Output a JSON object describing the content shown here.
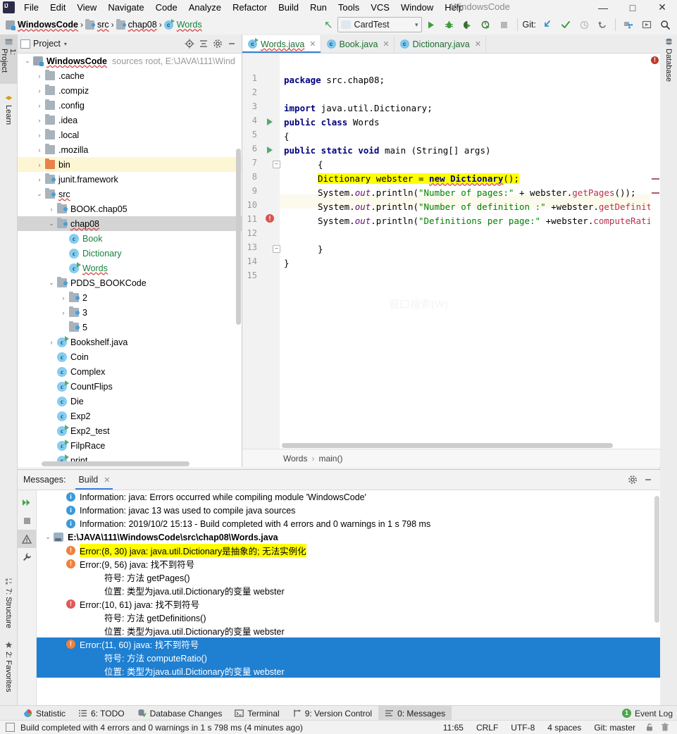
{
  "window": {
    "title": "WindowsCode",
    "minimize": "—",
    "maximize": "□",
    "close": "✕"
  },
  "menubar": {
    "items": [
      "File",
      "Edit",
      "View",
      "Navigate",
      "Code",
      "Analyze",
      "Refactor",
      "Build",
      "Run",
      "Tools",
      "VCS",
      "Window",
      "Help"
    ]
  },
  "navbar": {
    "breadcrumbs": [
      {
        "label": "WindowsCode",
        "icon": "module-icon",
        "style": "bold"
      },
      {
        "label": "src",
        "icon": "source-folder-icon",
        "style": "plain"
      },
      {
        "label": "chap08",
        "icon": "source-folder-icon",
        "style": "plain"
      },
      {
        "label": "Words",
        "icon": "java-class-runnable-icon",
        "style": "green"
      }
    ],
    "separator": "›",
    "run_config": {
      "value": "CardTest",
      "caret": "▾"
    },
    "git_label": "Git:",
    "icons": [
      "run-icon",
      "debug-icon",
      "run-with-coverage-icon",
      "profile-icon",
      "stop-icon",
      "update-project-icon",
      "commit-icon",
      "history-icon",
      "rollback-icon",
      "project-structure-icon",
      "select-in-icon",
      "search-everywhere-icon"
    ]
  },
  "left_stripe": {
    "top": [
      {
        "label": "1: Project",
        "icon": "project-icon",
        "active": true
      },
      {
        "label": "Learn",
        "icon": "learn-icon",
        "active": false
      }
    ],
    "bottom": [
      {
        "label": "7: Structure",
        "icon": "structure-icon",
        "active": false
      },
      {
        "label": "2: Favorites",
        "icon": "star-icon",
        "active": false
      }
    ]
  },
  "right_stripe": {
    "items": [
      {
        "label": "Database",
        "icon": "database-icon"
      }
    ]
  },
  "project_panel": {
    "title": "Project",
    "caret": "▾",
    "actions": [
      "locate-icon",
      "collapse-all-icon",
      "settings-gear-icon",
      "hide-icon"
    ],
    "tree": [
      {
        "indent": 0,
        "arrow": "v",
        "icon": "module-icon",
        "label": "WindowsCode",
        "style": "bold",
        "sub": "sources root,  E:\\JAVA\\111\\Wind",
        "state": "normal"
      },
      {
        "indent": 1,
        "arrow": ">",
        "icon": "folder-icon",
        "label": ".cache",
        "style": "plain",
        "sub": "",
        "state": "normal"
      },
      {
        "indent": 1,
        "arrow": ">",
        "icon": "folder-icon",
        "label": ".compiz",
        "style": "plain",
        "sub": "",
        "state": "normal"
      },
      {
        "indent": 1,
        "arrow": ">",
        "icon": "folder-icon",
        "label": ".config",
        "style": "plain",
        "sub": "",
        "state": "normal"
      },
      {
        "indent": 1,
        "arrow": ">",
        "icon": "folder-icon",
        "label": ".idea",
        "style": "plain",
        "sub": "",
        "state": "normal"
      },
      {
        "indent": 1,
        "arrow": ">",
        "icon": "folder-icon",
        "label": ".local",
        "style": "plain",
        "sub": "",
        "state": "normal"
      },
      {
        "indent": 1,
        "arrow": ">",
        "icon": "folder-icon",
        "label": ".mozilla",
        "style": "plain",
        "sub": "",
        "state": "normal"
      },
      {
        "indent": 1,
        "arrow": ">",
        "icon": "output-folder-icon",
        "label": "bin",
        "style": "plain",
        "sub": "",
        "state": "highlight"
      },
      {
        "indent": 1,
        "arrow": ">",
        "icon": "source-folder-icon",
        "label": "junit.framework",
        "style": "plain",
        "sub": "",
        "state": "normal"
      },
      {
        "indent": 1,
        "arrow": "v",
        "icon": "source-folder-icon",
        "label": "src",
        "style": "plain",
        "sub": "",
        "state": "normal"
      },
      {
        "indent": 2,
        "arrow": ">",
        "icon": "source-folder-icon",
        "label": "BOOK.chap05",
        "style": "plain",
        "sub": "",
        "state": "normal"
      },
      {
        "indent": 2,
        "arrow": "v",
        "icon": "source-folder-icon",
        "label": "chap08",
        "style": "plain",
        "sub": "",
        "state": "selected"
      },
      {
        "indent": 3,
        "arrow": "",
        "icon": "java-class-icon",
        "label": "Book",
        "style": "green",
        "sub": "",
        "state": "normal"
      },
      {
        "indent": 3,
        "arrow": "",
        "icon": "java-class-icon",
        "label": "Dictionary",
        "style": "green",
        "sub": "",
        "state": "normal"
      },
      {
        "indent": 3,
        "arrow": "",
        "icon": "java-class-runnable-icon",
        "label": "Words",
        "style": "green",
        "sub": "",
        "state": "normal"
      },
      {
        "indent": 2,
        "arrow": "v",
        "icon": "source-folder-icon",
        "label": "PDDS_BOOKCode",
        "style": "plain",
        "sub": "",
        "state": "normal"
      },
      {
        "indent": 3,
        "arrow": ">",
        "icon": "source-folder-icon",
        "label": "2",
        "style": "plain",
        "sub": "",
        "state": "normal"
      },
      {
        "indent": 3,
        "arrow": ">",
        "icon": "source-folder-icon",
        "label": "3",
        "style": "plain",
        "sub": "",
        "state": "normal"
      },
      {
        "indent": 3,
        "arrow": "",
        "icon": "source-folder-icon",
        "label": "5",
        "style": "plain",
        "sub": "",
        "state": "normal"
      },
      {
        "indent": 2,
        "arrow": ">",
        "icon": "java-class-runnable-icon",
        "label": "Bookshelf.java",
        "style": "plain",
        "sub": "",
        "state": "normal"
      },
      {
        "indent": 2,
        "arrow": "",
        "icon": "java-class-icon",
        "label": "Coin",
        "style": "plain",
        "sub": "",
        "state": "normal"
      },
      {
        "indent": 2,
        "arrow": "",
        "icon": "java-class-icon",
        "label": "Complex",
        "style": "plain",
        "sub": "",
        "state": "normal"
      },
      {
        "indent": 2,
        "arrow": "",
        "icon": "java-class-runnable-icon",
        "label": "CountFlips",
        "style": "plain",
        "sub": "",
        "state": "normal"
      },
      {
        "indent": 2,
        "arrow": "",
        "icon": "java-class-icon",
        "label": "Die",
        "style": "plain",
        "sub": "",
        "state": "normal"
      },
      {
        "indent": 2,
        "arrow": "",
        "icon": "java-class-icon",
        "label": "Exp2",
        "style": "plain",
        "sub": "",
        "state": "normal"
      },
      {
        "indent": 2,
        "arrow": "",
        "icon": "java-class-runnable-icon",
        "label": "Exp2_test",
        "style": "plain",
        "sub": "",
        "state": "normal"
      },
      {
        "indent": 2,
        "arrow": "",
        "icon": "java-class-runnable-icon",
        "label": "FilpRace",
        "style": "plain",
        "sub": "",
        "state": "normal"
      },
      {
        "indent": 2,
        "arrow": "",
        "icon": "java-class-runnable-icon",
        "label": "print",
        "style": "plain",
        "sub": "",
        "state": "normal"
      }
    ]
  },
  "editor": {
    "tabs": [
      {
        "label": "Words.java",
        "icon": "java-class-runnable-icon",
        "active": true,
        "close": "✕",
        "color": "green"
      },
      {
        "label": "Book.java",
        "icon": "java-class-icon",
        "active": false,
        "close": "✕",
        "color": "green"
      },
      {
        "label": "Dictionary.java",
        "icon": "java-class-icon",
        "active": false,
        "close": "✕",
        "color": "green"
      }
    ],
    "line_numbers": [
      "1",
      "2",
      "3",
      "4",
      "5",
      "6",
      "7",
      "8",
      "9",
      "10",
      "11",
      "12",
      "13",
      "14",
      "15"
    ],
    "code": [
      "package src.chap08;",
      "",
      "import java.util.Dictionary;",
      "public class Words",
      "{",
      "public static void main (String[] args)",
      "        {",
      "        Dictionary webster = new Dictionary();",
      "        System.out.println(\"Number of pages:\" + webster.getPages());",
      "        System.out.println(\"Number of definition :\" +webster.getDefinitions(",
      "        System.out.println(\"Definitions per page:\" +webster.computeRatio());",
      "",
      "        }",
      "}",
      ""
    ],
    "watermark": "窗口搜索(W)",
    "error_marker_count": "!",
    "breadcrumb": {
      "items": [
        "Words",
        "main()"
      ],
      "separator": "›"
    }
  },
  "messages": {
    "label": "Messages:",
    "tab": {
      "label": "Build",
      "close": "✕"
    },
    "header_actions": [
      "settings-gear-icon",
      "hide-icon"
    ],
    "toolbar_icons": [
      "rerun-icon",
      "stop-icon",
      "toggle-warnings-icon",
      "settings-wrench-icon"
    ],
    "rows": [
      {
        "type": "info",
        "indent": 1,
        "text": "Information: java: Errors occurred while compiling module 'WindowsCode'",
        "state": "normal"
      },
      {
        "type": "info",
        "indent": 1,
        "text": "Information: javac 13 was used to compile java sources",
        "state": "normal"
      },
      {
        "type": "info",
        "indent": 1,
        "text": "Information: 2019/10/2 15:13 - Build completed with 4 errors and 0 warnings in 1 s 798 ms",
        "state": "normal"
      },
      {
        "type": "file",
        "indent": 0,
        "arrow": "v",
        "text": "E:\\JAVA\\111\\WindowsCode\\src\\chap08\\Words.java",
        "state": "normal"
      },
      {
        "type": "error",
        "indent": 1,
        "text": "Error:(8, 30)  java: java.util.Dictionary是抽象的; 无法实例化",
        "state": "highlight"
      },
      {
        "type": "error",
        "indent": 1,
        "text": "Error:(9, 56)  java: 找不到符号",
        "state": "normal"
      },
      {
        "type": "plain",
        "indent": 4,
        "text": "符号:   方法 getPages()",
        "state": "normal"
      },
      {
        "type": "plain",
        "indent": 4,
        "text": "位置: 类型为java.util.Dictionary的变量 webster",
        "state": "normal"
      },
      {
        "type": "error",
        "indent": 1,
        "text": "Error:(10, 61)  java: 找不到符号",
        "state": "normal"
      },
      {
        "type": "plain",
        "indent": 4,
        "text": "符号:   方法 getDefinitions()",
        "state": "normal"
      },
      {
        "type": "plain",
        "indent": 4,
        "text": "位置: 类型为java.util.Dictionary的变量 webster",
        "state": "normal"
      },
      {
        "type": "error",
        "indent": 1,
        "text": "Error:(11, 60)  java: 找不到符号",
        "state": "selected"
      },
      {
        "type": "plain",
        "indent": 4,
        "text": "符号:   方法 computeRatio()",
        "state": "selected"
      },
      {
        "type": "plain",
        "indent": 4,
        "text": "位置: 类型为java.util.Dictionary的变量 webster",
        "state": "selected"
      }
    ]
  },
  "bottom_stripe": {
    "items": [
      {
        "label": "Statistic",
        "icon": "statistic-icon",
        "active": false
      },
      {
        "label": "6: TODO",
        "icon": "todo-icon",
        "active": false
      },
      {
        "label": "Database Changes",
        "icon": "database-changes-icon",
        "active": false
      },
      {
        "label": "Terminal",
        "icon": "terminal-icon",
        "active": false
      },
      {
        "label": "9: Version Control",
        "icon": "version-control-icon",
        "active": false
      },
      {
        "label": "0: Messages",
        "icon": "messages-icon",
        "active": true
      }
    ],
    "event_log": {
      "label": "Event Log",
      "badge": "1"
    }
  },
  "statusbar": {
    "message": "Build completed with 4 errors and 0 warnings in 1 s 798 ms (4 minutes ago)",
    "caret_position": "11:65",
    "line_separator": "CRLF",
    "encoding": "UTF-8",
    "indent": "4 spaces",
    "git_branch": "Git: master",
    "icons": [
      "lock-icon",
      "trash-icon"
    ]
  },
  "colors": {
    "accent_blue": "#1f7fd1",
    "tab_underline": "#3c7fd6",
    "error_red": "#c0392b",
    "highlight_yellow": "#ffff00",
    "green_run": "#59a869",
    "string_green": "#008000",
    "keyword_blue": "#000080"
  }
}
